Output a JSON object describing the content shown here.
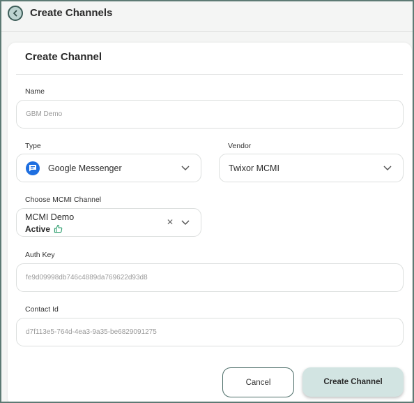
{
  "header": {
    "back_icon": "back-arrow-icon",
    "title": "Create Channels"
  },
  "form": {
    "title": "Create Channel",
    "name": {
      "label": "Name",
      "value": "GBM Demo"
    },
    "type": {
      "label": "Type",
      "value": "Google Messenger",
      "icon": "google-messages-icon"
    },
    "vendor": {
      "label": "Vendor",
      "value": "Twixor MCMI"
    },
    "mcmi_channel": {
      "label": "Choose MCMI Channel",
      "value": "MCMI Demo",
      "status": "Active",
      "status_icon": "thumbs-up-icon"
    },
    "auth_key": {
      "label": "Auth Key",
      "value": "fe9d09998db746c4889da769622d93d8"
    },
    "contact_id": {
      "label": "Contact Id",
      "value": "d7f113e5-764d-4ea3-9a35-be6829091275"
    }
  },
  "actions": {
    "cancel_label": "Cancel",
    "create_label": "Create Channel"
  },
  "colors": {
    "accent": "#d2e4e2",
    "border_accent": "#4d6e69",
    "google_blue": "#1f6fe0",
    "active_green": "#2e9e6e"
  }
}
